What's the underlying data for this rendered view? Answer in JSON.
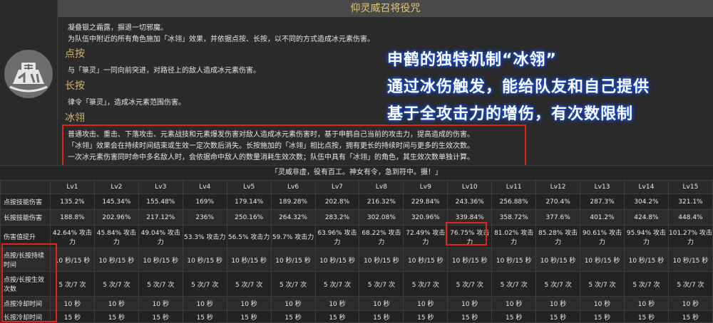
{
  "skill": {
    "title": "仰灵威召将役咒",
    "intro_line1": "凝叠银之霜露，摒退一切邪魔。",
    "intro_line2": "为队伍中附近的所有角色施加「冰翎」效果，并依据点按、长按，以不同的方式造成冰元素伤害。",
    "press_heading": "点按",
    "press_text": "与「箓灵」一同向前突进，对路径上的敌人造成冰元素伤害。",
    "hold_heading": "长按",
    "hold_text": "律令「箓灵」，造成冰元素范围伤害。",
    "icy_heading": "冰翎",
    "icy_line1": "普通攻击、重击、下落攻击、元素战技和元素爆发伤害对敌人造成冰元素伤害时，基于申鹤自己当前的攻击力，提高造成的伤害。",
    "icy_line2": "「冰翎」效果会在持续时间结束或生效一定次数后消失。长按施加的「冰翎」相比点按，拥有更长的持续时间与更多的生效次数。",
    "icy_line3": "一次冰元素伤害同时命中多名敌人时，会依据命中敌人的数量消耗生效次数；队伍中具有「冰翎」的角色，其生效次数单独计算。",
    "quote": "「灵威非虚，役有百工。神女有令，急到符中。摄！」"
  },
  "overlay": {
    "line1": "申鹤的独特机制“冰翎”",
    "line2": "通过冰伤触发，能给队友和自己提供",
    "line3": "基于全攻击力的增伤，有次数限制"
  },
  "table": {
    "levels": [
      "Lv1",
      "Lv2",
      "Lv3",
      "Lv4",
      "Lv5",
      "Lv6",
      "Lv7",
      "Lv8",
      "Lv9",
      "Lv10",
      "Lv11",
      "Lv12",
      "Lv13",
      "Lv14",
      "Lv15"
    ],
    "rows": [
      {
        "label": "点按技能伤害",
        "cls": "r1",
        "values": [
          "135.2%",
          "145.34%",
          "155.48%",
          "169%",
          "179.14%",
          "189.28%",
          "202.8%",
          "216.32%",
          "229.84%",
          "243.36%",
          "256.88%",
          "270.4%",
          "287.3%",
          "304.2%",
          "321.1%"
        ]
      },
      {
        "label": "长按技能伤害",
        "cls": "r1",
        "values": [
          "188.8%",
          "202.96%",
          "217.12%",
          "236%",
          "250.16%",
          "264.32%",
          "283.2%",
          "302.08%",
          "320.96%",
          "339.84%",
          "358.72%",
          "377.6%",
          "401.2%",
          "424.8%",
          "448.4%"
        ]
      },
      {
        "label": "伤害值提升",
        "cls": "r3",
        "values": [
          "42.64% 攻击力",
          "45.84% 攻击力",
          "49.04% 攻击力",
          "53.3% 攻击力",
          "56.5% 攻击力",
          "59.7% 攻击力",
          "63.96% 攻击力",
          "68.22% 攻击力",
          "72.49% 攻击力",
          "76.75% 攻击力",
          "81.02% 攻击力",
          "85.28% 攻击力",
          "90.61% 攻击力",
          "95.94% 攻击力",
          "101.27% 攻击力"
        ]
      },
      {
        "label": "点按/长按持续时间",
        "cls": "r4",
        "values": [
          "10 秒/15 秒",
          "10 秒/15 秒",
          "10 秒/15 秒",
          "10 秒/15 秒",
          "10 秒/15 秒",
          "10 秒/15 秒",
          "10 秒/15 秒",
          "10 秒/15 秒",
          "10 秒/15 秒",
          "10 秒/15 秒",
          "10 秒/15 秒",
          "10 秒/15 秒",
          "10 秒/15 秒",
          "10 秒/15 秒",
          "10 秒/15 秒"
        ]
      },
      {
        "label": "点按/长按生效次数",
        "cls": "r5",
        "values": [
          "5 次/7 次",
          "5 次/7 次",
          "5 次/7 次",
          "5 次/7 次",
          "5 次/7 次",
          "5 次/7 次",
          "5 次/7 次",
          "5 次/7 次",
          "5 次/7 次",
          "5 次/7 次",
          "5 次/7 次",
          "5 次/7 次",
          "5 次/7 次",
          "5 次/7 次",
          "5 次/7 次"
        ]
      },
      {
        "label": "点按冷却时间",
        "cls": "r6",
        "values": [
          "10 秒",
          "10 秒",
          "10 秒",
          "10 秒",
          "10 秒",
          "10 秒",
          "10 秒",
          "10 秒",
          "10 秒",
          "10 秒",
          "10 秒",
          "10 秒",
          "10 秒",
          "10 秒",
          "10 秒"
        ]
      },
      {
        "label": "长按冷却时间",
        "cls": "r7",
        "values": [
          "15 秒",
          "15 秒",
          "15 秒",
          "15 秒",
          "15 秒",
          "15 秒",
          "15 秒",
          "15 秒",
          "15 秒",
          "15 秒",
          "15 秒",
          "15 秒",
          "15 秒",
          "15 秒",
          "15 秒"
        ]
      }
    ]
  },
  "colors": {
    "highlight_box": "#e0231c",
    "heading": "#d8b36a",
    "overlay_glow": "#1a4fd6"
  }
}
